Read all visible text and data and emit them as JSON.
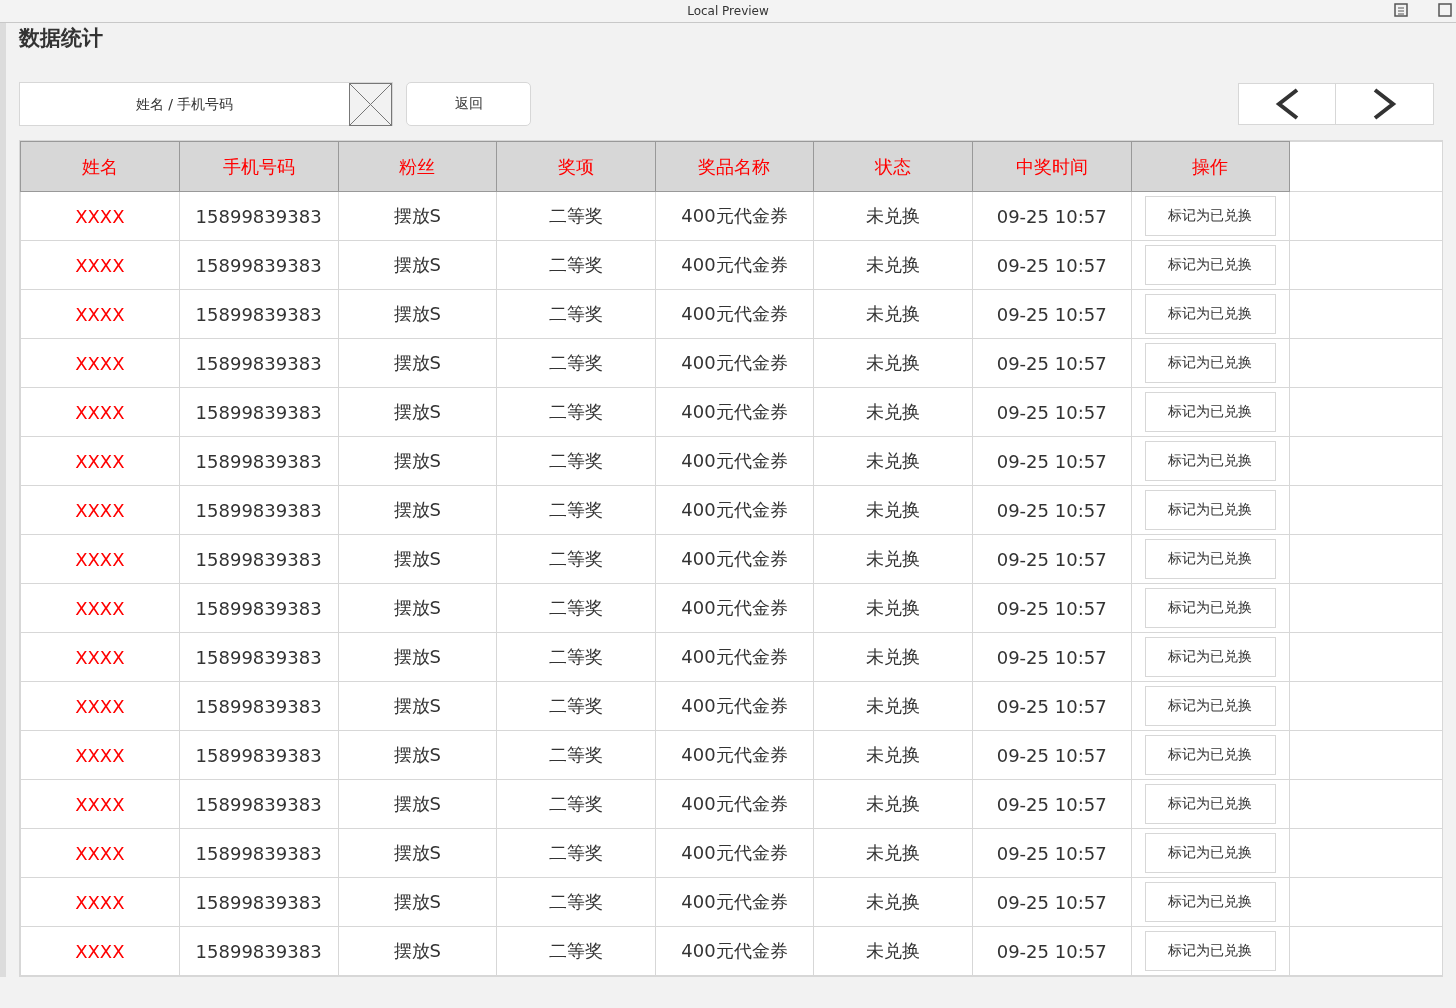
{
  "window": {
    "title": "Local Preview"
  },
  "page": {
    "title": "数据统计"
  },
  "search": {
    "placeholder": "姓名 / 手机号码"
  },
  "back_button": "返回",
  "table": {
    "columns": [
      "姓名",
      "手机号码",
      "粉丝",
      "奖项",
      "奖品名称",
      "状态",
      "中奖时间",
      "操作"
    ],
    "rows": [
      {
        "name": "XXXX",
        "phone": "15899839383",
        "fan": "摆放S",
        "prize_level": "二等奖",
        "prize": "400元代金券",
        "status": "未兑换",
        "time": "09-25 10:57",
        "action": "标记为已兑换"
      },
      {
        "name": "XXXX",
        "phone": "15899839383",
        "fan": "摆放S",
        "prize_level": "二等奖",
        "prize": "400元代金券",
        "status": "未兑换",
        "time": "09-25 10:57",
        "action": "标记为已兑换"
      },
      {
        "name": "XXXX",
        "phone": "15899839383",
        "fan": "摆放S",
        "prize_level": "二等奖",
        "prize": "400元代金券",
        "status": "未兑换",
        "time": "09-25 10:57",
        "action": "标记为已兑换"
      },
      {
        "name": "XXXX",
        "phone": "15899839383",
        "fan": "摆放S",
        "prize_level": "二等奖",
        "prize": "400元代金券",
        "status": "未兑换",
        "time": "09-25 10:57",
        "action": "标记为已兑换"
      },
      {
        "name": "XXXX",
        "phone": "15899839383",
        "fan": "摆放S",
        "prize_level": "二等奖",
        "prize": "400元代金券",
        "status": "未兑换",
        "time": "09-25 10:57",
        "action": "标记为已兑换"
      },
      {
        "name": "XXXX",
        "phone": "15899839383",
        "fan": "摆放S",
        "prize_level": "二等奖",
        "prize": "400元代金券",
        "status": "未兑换",
        "time": "09-25 10:57",
        "action": "标记为已兑换"
      },
      {
        "name": "XXXX",
        "phone": "15899839383",
        "fan": "摆放S",
        "prize_level": "二等奖",
        "prize": "400元代金券",
        "status": "未兑换",
        "time": "09-25 10:57",
        "action": "标记为已兑换"
      },
      {
        "name": "XXXX",
        "phone": "15899839383",
        "fan": "摆放S",
        "prize_level": "二等奖",
        "prize": "400元代金券",
        "status": "未兑换",
        "time": "09-25 10:57",
        "action": "标记为已兑换"
      },
      {
        "name": "XXXX",
        "phone": "15899839383",
        "fan": "摆放S",
        "prize_level": "二等奖",
        "prize": "400元代金券",
        "status": "未兑换",
        "time": "09-25 10:57",
        "action": "标记为已兑换"
      },
      {
        "name": "XXXX",
        "phone": "15899839383",
        "fan": "摆放S",
        "prize_level": "二等奖",
        "prize": "400元代金券",
        "status": "未兑换",
        "time": "09-25 10:57",
        "action": "标记为已兑换"
      },
      {
        "name": "XXXX",
        "phone": "15899839383",
        "fan": "摆放S",
        "prize_level": "二等奖",
        "prize": "400元代金券",
        "status": "未兑换",
        "time": "09-25 10:57",
        "action": "标记为已兑换"
      },
      {
        "name": "XXXX",
        "phone": "15899839383",
        "fan": "摆放S",
        "prize_level": "二等奖",
        "prize": "400元代金券",
        "status": "未兑换",
        "time": "09-25 10:57",
        "action": "标记为已兑换"
      },
      {
        "name": "XXXX",
        "phone": "15899839383",
        "fan": "摆放S",
        "prize_level": "二等奖",
        "prize": "400元代金券",
        "status": "未兑换",
        "time": "09-25 10:57",
        "action": "标记为已兑换"
      },
      {
        "name": "XXXX",
        "phone": "15899839383",
        "fan": "摆放S",
        "prize_level": "二等奖",
        "prize": "400元代金券",
        "status": "未兑换",
        "time": "09-25 10:57",
        "action": "标记为已兑换"
      },
      {
        "name": "XXXX",
        "phone": "15899839383",
        "fan": "摆放S",
        "prize_level": "二等奖",
        "prize": "400元代金券",
        "status": "未兑换",
        "time": "09-25 10:57",
        "action": "标记为已兑换"
      },
      {
        "name": "XXXX",
        "phone": "15899839383",
        "fan": "摆放S",
        "prize_level": "二等奖",
        "prize": "400元代金券",
        "status": "未兑换",
        "time": "09-25 10:57",
        "action": "标记为已兑换"
      }
    ]
  }
}
